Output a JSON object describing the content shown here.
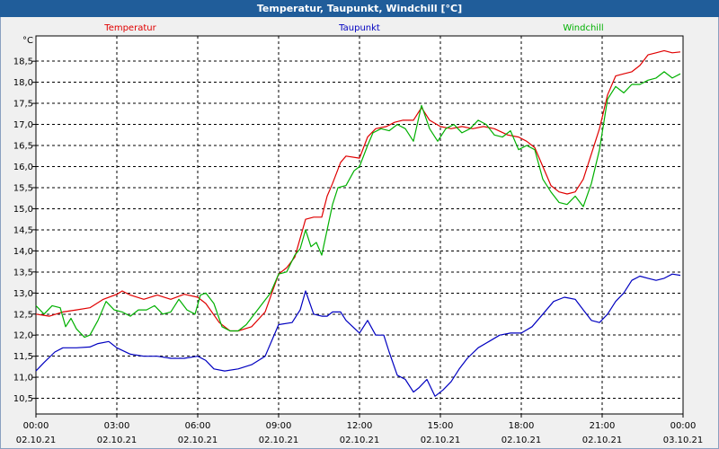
{
  "window": {
    "title": "Temperatur, Taupunkt, Windchill [°C]"
  },
  "chart_data": {
    "type": "line",
    "title": "Temperatur, Taupunkt, Windchill [°C]",
    "ylabel": "°C",
    "xlabel": "",
    "ylim": [
      10.13,
      19.1
    ],
    "xlim": [
      0,
      24
    ],
    "grid": true,
    "legend_placement": "top",
    "yticks": [
      "10,5",
      "11,0",
      "11,5",
      "12,0",
      "12,5",
      "13,0",
      "13,5",
      "14,0",
      "14,5",
      "15,0",
      "15,5",
      "16,0",
      "16,5",
      "17,0",
      "17,5",
      "18,0",
      "18,5"
    ],
    "ytick_values": [
      10.5,
      11.0,
      11.5,
      12.0,
      12.5,
      13.0,
      13.5,
      14.0,
      14.5,
      15.0,
      15.5,
      16.0,
      16.5,
      17.0,
      17.5,
      18.0,
      18.5
    ],
    "xtick_times": [
      "00:00",
      "03:00",
      "06:00",
      "09:00",
      "12:00",
      "15:00",
      "18:00",
      "21:00",
      "00:00"
    ],
    "xtick_dates": [
      "02.10.21",
      "02.10.21",
      "02.10.21",
      "02.10.21",
      "02.10.21",
      "02.10.21",
      "02.10.21",
      "02.10.21",
      "03.10.21"
    ],
    "xtick_values": [
      0,
      3,
      6,
      9,
      12,
      15,
      18,
      21,
      24
    ],
    "series": [
      {
        "name": "Temperatur",
        "color": "#e00000",
        "legend_x_hours": 3.5,
        "points": [
          [
            0,
            12.5
          ],
          [
            0.5,
            12.45
          ],
          [
            1,
            12.55
          ],
          [
            1.5,
            12.6
          ],
          [
            2,
            12.65
          ],
          [
            2.5,
            12.85
          ],
          [
            3,
            12.97
          ],
          [
            3.2,
            13.05
          ],
          [
            3.5,
            12.95
          ],
          [
            4,
            12.85
          ],
          [
            4.5,
            12.95
          ],
          [
            5,
            12.85
          ],
          [
            5.5,
            12.97
          ],
          [
            6,
            12.9
          ],
          [
            6.3,
            12.75
          ],
          [
            6.8,
            12.3
          ],
          [
            7.2,
            12.1
          ],
          [
            7.5,
            12.1
          ],
          [
            8,
            12.2
          ],
          [
            8.5,
            12.55
          ],
          [
            9,
            13.45
          ],
          [
            9.3,
            13.6
          ],
          [
            9.6,
            13.85
          ],
          [
            9.8,
            14.3
          ],
          [
            10,
            14.75
          ],
          [
            10.3,
            14.8
          ],
          [
            10.6,
            14.8
          ],
          [
            10.8,
            15.3
          ],
          [
            11,
            15.6
          ],
          [
            11.3,
            16.1
          ],
          [
            11.5,
            16.25
          ],
          [
            12,
            16.2
          ],
          [
            12.3,
            16.7
          ],
          [
            12.6,
            16.9
          ],
          [
            13,
            16.95
          ],
          [
            13.3,
            17.05
          ],
          [
            13.6,
            17.1
          ],
          [
            14,
            17.1
          ],
          [
            14.3,
            17.4
          ],
          [
            14.6,
            17.1
          ],
          [
            15,
            16.95
          ],
          [
            15.4,
            16.9
          ],
          [
            15.8,
            16.95
          ],
          [
            16.2,
            16.9
          ],
          [
            16.6,
            16.95
          ],
          [
            17,
            16.9
          ],
          [
            17.5,
            16.75
          ],
          [
            17.9,
            16.7
          ],
          [
            18.2,
            16.6
          ],
          [
            18.5,
            16.45
          ],
          [
            18.8,
            16.0
          ],
          [
            19.1,
            15.55
          ],
          [
            19.4,
            15.4
          ],
          [
            19.7,
            15.35
          ],
          [
            20,
            15.4
          ],
          [
            20.3,
            15.7
          ],
          [
            20.6,
            16.3
          ],
          [
            20.9,
            16.9
          ],
          [
            21.2,
            17.7
          ],
          [
            21.5,
            18.15
          ],
          [
            21.8,
            18.2
          ],
          [
            22.1,
            18.25
          ],
          [
            22.4,
            18.4
          ],
          [
            22.7,
            18.65
          ],
          [
            23,
            18.7
          ],
          [
            23.3,
            18.75
          ],
          [
            23.6,
            18.7
          ],
          [
            23.9,
            18.72
          ]
        ]
      },
      {
        "name": "Taupunkt",
        "color": "#0000c0",
        "legend_x_hours": 12.0,
        "points": [
          [
            0,
            11.15
          ],
          [
            0.3,
            11.35
          ],
          [
            0.7,
            11.6
          ],
          [
            1,
            11.7
          ],
          [
            1.5,
            11.7
          ],
          [
            2,
            11.72
          ],
          [
            2.3,
            11.8
          ],
          [
            2.7,
            11.85
          ],
          [
            3,
            11.7
          ],
          [
            3.5,
            11.55
          ],
          [
            4,
            11.5
          ],
          [
            4.5,
            11.5
          ],
          [
            5,
            11.45
          ],
          [
            5.5,
            11.45
          ],
          [
            6,
            11.5
          ],
          [
            6.3,
            11.4
          ],
          [
            6.6,
            11.2
          ],
          [
            7,
            11.15
          ],
          [
            7.5,
            11.2
          ],
          [
            8,
            11.3
          ],
          [
            8.5,
            11.5
          ],
          [
            9,
            12.25
          ],
          [
            9.5,
            12.3
          ],
          [
            9.8,
            12.6
          ],
          [
            10,
            13.05
          ],
          [
            10.3,
            12.5
          ],
          [
            10.6,
            12.45
          ],
          [
            10.8,
            12.45
          ],
          [
            11,
            12.55
          ],
          [
            11.3,
            12.55
          ],
          [
            11.5,
            12.35
          ],
          [
            12,
            12.05
          ],
          [
            12.3,
            12.35
          ],
          [
            12.6,
            12.0
          ],
          [
            12.9,
            12.0
          ],
          [
            13.1,
            11.6
          ],
          [
            13.4,
            11.05
          ],
          [
            13.7,
            10.95
          ],
          [
            14,
            10.65
          ],
          [
            14.2,
            10.75
          ],
          [
            14.5,
            10.95
          ],
          [
            14.8,
            10.55
          ],
          [
            15.1,
            10.7
          ],
          [
            15.4,
            10.9
          ],
          [
            15.7,
            11.2
          ],
          [
            16,
            11.45
          ],
          [
            16.4,
            11.7
          ],
          [
            16.8,
            11.85
          ],
          [
            17.2,
            12.0
          ],
          [
            17.6,
            12.05
          ],
          [
            18,
            12.05
          ],
          [
            18.4,
            12.2
          ],
          [
            18.8,
            12.5
          ],
          [
            19.2,
            12.8
          ],
          [
            19.6,
            12.9
          ],
          [
            20,
            12.85
          ],
          [
            20.3,
            12.6
          ],
          [
            20.6,
            12.35
          ],
          [
            20.9,
            12.3
          ],
          [
            21.2,
            12.5
          ],
          [
            21.5,
            12.8
          ],
          [
            21.8,
            13.0
          ],
          [
            22.1,
            13.3
          ],
          [
            22.4,
            13.4
          ],
          [
            22.7,
            13.35
          ],
          [
            23,
            13.3
          ],
          [
            23.3,
            13.35
          ],
          [
            23.6,
            13.45
          ],
          [
            23.9,
            13.42
          ]
        ]
      },
      {
        "name": "Windchill",
        "color": "#00b000",
        "legend_x_hours": 20.3,
        "points": [
          [
            0,
            12.7
          ],
          [
            0.3,
            12.5
          ],
          [
            0.6,
            12.7
          ],
          [
            0.9,
            12.65
          ],
          [
            1.1,
            12.2
          ],
          [
            1.3,
            12.4
          ],
          [
            1.5,
            12.15
          ],
          [
            1.8,
            11.95
          ],
          [
            2,
            12.0
          ],
          [
            2.3,
            12.35
          ],
          [
            2.6,
            12.8
          ],
          [
            2.9,
            12.6
          ],
          [
            3.2,
            12.55
          ],
          [
            3.5,
            12.45
          ],
          [
            3.8,
            12.6
          ],
          [
            4.1,
            12.6
          ],
          [
            4.4,
            12.7
          ],
          [
            4.7,
            12.5
          ],
          [
            5,
            12.55
          ],
          [
            5.3,
            12.85
          ],
          [
            5.6,
            12.6
          ],
          [
            5.9,
            12.5
          ],
          [
            6.1,
            12.95
          ],
          [
            6.3,
            13.0
          ],
          [
            6.6,
            12.75
          ],
          [
            6.9,
            12.2
          ],
          [
            7.2,
            12.1
          ],
          [
            7.5,
            12.1
          ],
          [
            7.8,
            12.25
          ],
          [
            8.1,
            12.5
          ],
          [
            8.4,
            12.75
          ],
          [
            8.7,
            13.0
          ],
          [
            9,
            13.45
          ],
          [
            9.3,
            13.5
          ],
          [
            9.6,
            13.9
          ],
          [
            9.8,
            14.05
          ],
          [
            10,
            14.5
          ],
          [
            10.2,
            14.1
          ],
          [
            10.4,
            14.2
          ],
          [
            10.6,
            13.9
          ],
          [
            10.8,
            14.5
          ],
          [
            11,
            15.1
          ],
          [
            11.2,
            15.5
          ],
          [
            11.5,
            15.55
          ],
          [
            11.8,
            15.9
          ],
          [
            12,
            16.0
          ],
          [
            12.3,
            16.5
          ],
          [
            12.5,
            16.8
          ],
          [
            12.8,
            16.9
          ],
          [
            13.1,
            16.85
          ],
          [
            13.4,
            17.0
          ],
          [
            13.7,
            16.9
          ],
          [
            14,
            16.6
          ],
          [
            14.3,
            17.45
          ],
          [
            14.6,
            16.9
          ],
          [
            14.9,
            16.6
          ],
          [
            15.2,
            16.9
          ],
          [
            15.5,
            17.0
          ],
          [
            15.8,
            16.8
          ],
          [
            16.1,
            16.9
          ],
          [
            16.4,
            17.1
          ],
          [
            16.7,
            17.0
          ],
          [
            17,
            16.75
          ],
          [
            17.3,
            16.7
          ],
          [
            17.6,
            16.85
          ],
          [
            17.9,
            16.4
          ],
          [
            18.2,
            16.5
          ],
          [
            18.5,
            16.4
          ],
          [
            18.8,
            15.7
          ],
          [
            19.1,
            15.4
          ],
          [
            19.4,
            15.15
          ],
          [
            19.7,
            15.1
          ],
          [
            20,
            15.3
          ],
          [
            20.3,
            15.05
          ],
          [
            20.6,
            15.6
          ],
          [
            20.9,
            16.4
          ],
          [
            21.2,
            17.6
          ],
          [
            21.5,
            17.9
          ],
          [
            21.8,
            17.75
          ],
          [
            22.1,
            17.95
          ],
          [
            22.4,
            17.95
          ],
          [
            22.7,
            18.05
          ],
          [
            23,
            18.1
          ],
          [
            23.3,
            18.25
          ],
          [
            23.6,
            18.1
          ],
          [
            23.9,
            18.2
          ]
        ]
      }
    ]
  }
}
